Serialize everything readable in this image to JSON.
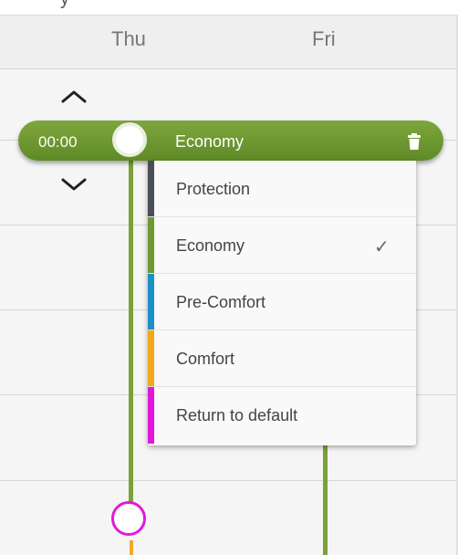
{
  "header": {
    "top_partial": "y",
    "days": [
      "Thu",
      "Fri"
    ]
  },
  "schedule": {
    "time": "00:00",
    "mode": "Economy",
    "color": "#6f9a31"
  },
  "icons": {
    "up": "chevron-up-icon",
    "down": "chevron-down-icon",
    "delete": "trash-icon",
    "selected": "checkmark-icon"
  },
  "dropdown": {
    "options": [
      {
        "label": "Protection",
        "color": "#4a4f57",
        "selected": false
      },
      {
        "label": "Economy",
        "color": "#6f9a31",
        "selected": true
      },
      {
        "label": "Pre-Comfort",
        "color": "#1e8fc6",
        "selected": false
      },
      {
        "label": "Comfort",
        "color": "#f2a71b",
        "selected": false
      },
      {
        "label": "Return to default",
        "color": "#e416dc",
        "selected": false
      }
    ]
  },
  "checkmark": "✓"
}
